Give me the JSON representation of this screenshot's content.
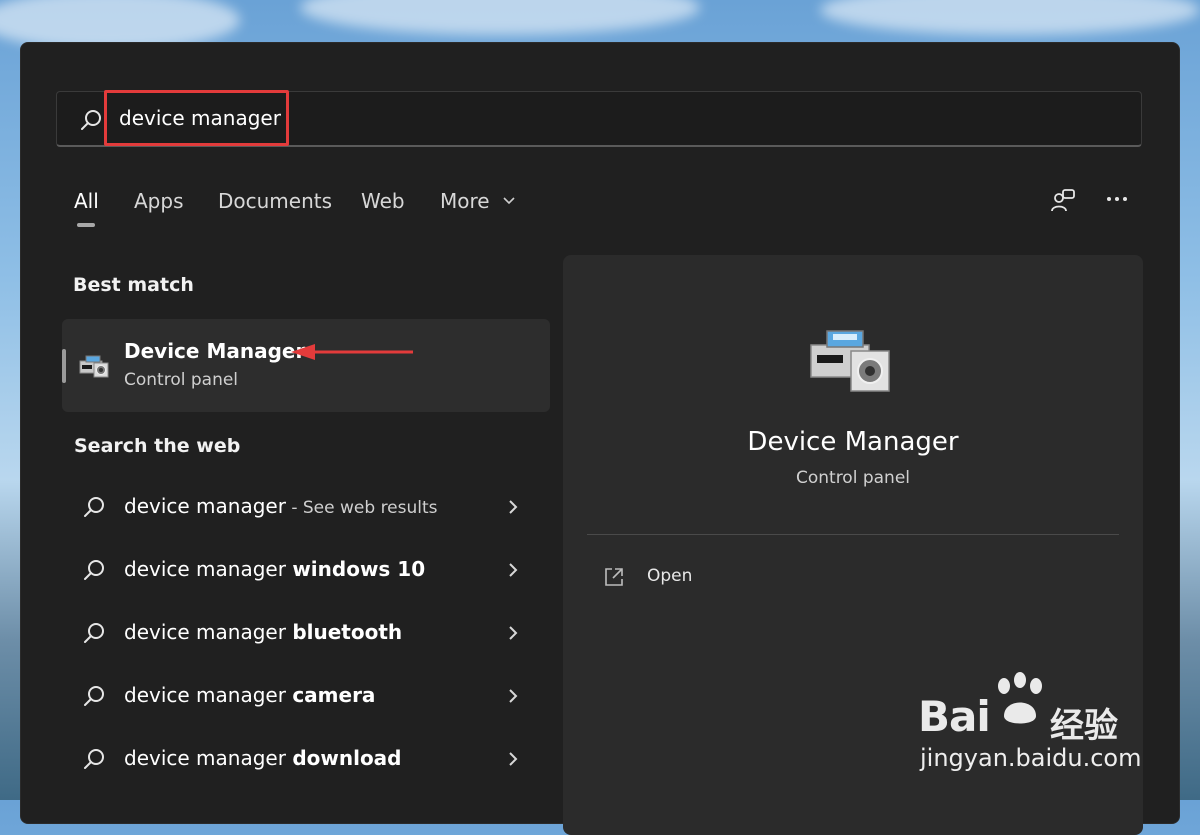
{
  "search": {
    "query": "device manager"
  },
  "tabs": [
    {
      "label": "All"
    },
    {
      "label": "Apps"
    },
    {
      "label": "Documents"
    },
    {
      "label": "Web"
    },
    {
      "label": "More"
    }
  ],
  "sections": {
    "best_match": "Best match",
    "search_web": "Search the web"
  },
  "best_match": {
    "title": "Device Manager",
    "subtitle": "Control panel"
  },
  "web_results": [
    {
      "prefix": "device manager",
      "bold": "",
      "hint": " - See web results"
    },
    {
      "prefix": "device manager ",
      "bold": "windows 10",
      "hint": ""
    },
    {
      "prefix": "device manager ",
      "bold": "bluetooth",
      "hint": ""
    },
    {
      "prefix": "device manager ",
      "bold": "camera",
      "hint": ""
    },
    {
      "prefix": "device manager ",
      "bold": "download",
      "hint": ""
    }
  ],
  "preview": {
    "title": "Device Manager",
    "subtitle": "Control panel",
    "open_label": "Open"
  },
  "watermark": {
    "brand": "Bai",
    "cn": "经验",
    "url": "jingyan.baidu.com"
  },
  "colors": {
    "panel": "#202020",
    "highlight": "#e33b3b",
    "item_bg": "#2d2d2d"
  }
}
